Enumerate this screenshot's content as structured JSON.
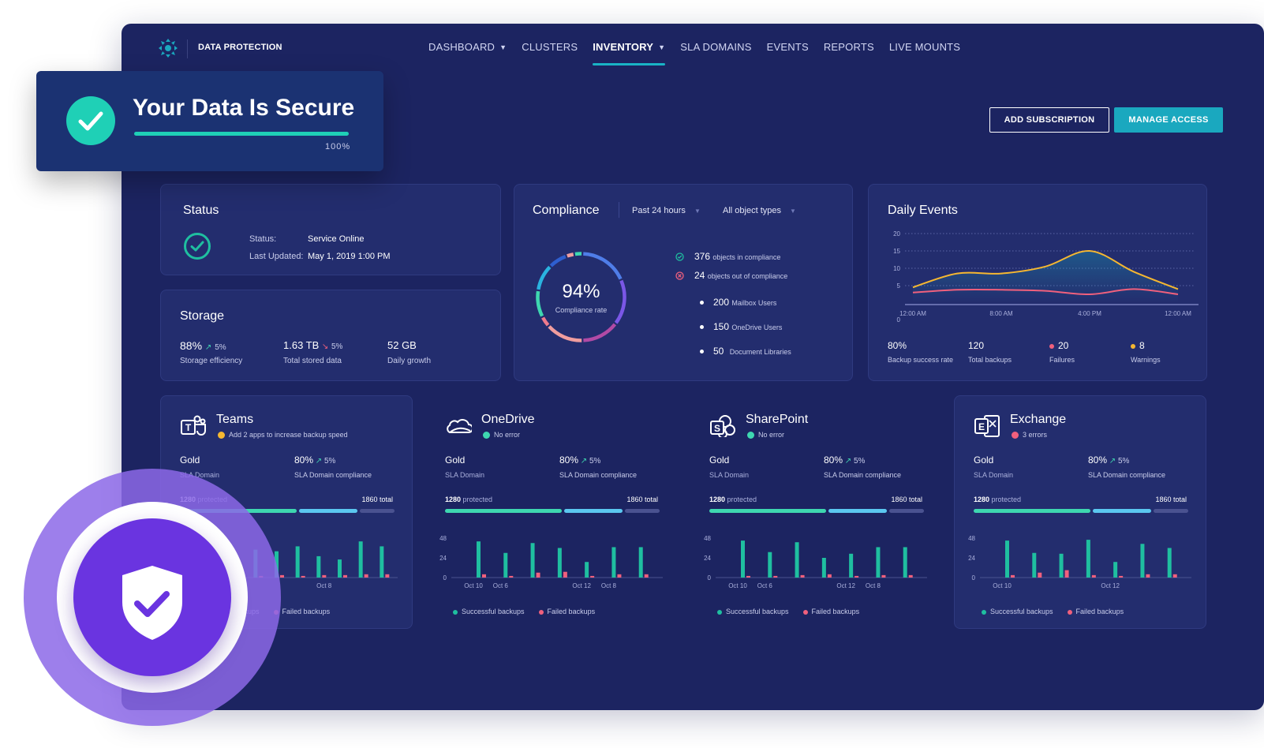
{
  "header": {
    "brand": "DATA PROTECTION",
    "nav": [
      {
        "label": "DASHBOARD",
        "dropdown": true,
        "active": false
      },
      {
        "label": "CLUSTERS",
        "dropdown": false,
        "active": false
      },
      {
        "label": "INVENTORY",
        "dropdown": true,
        "active": true
      },
      {
        "label": "SLA DOMAINS",
        "dropdown": false,
        "active": false
      },
      {
        "label": "EVENTS",
        "dropdown": false,
        "active": false
      },
      {
        "label": "REPORTS",
        "dropdown": false,
        "active": false
      },
      {
        "label": "LIVE MOUNTS",
        "dropdown": false,
        "active": false
      }
    ],
    "add_subscription": "ADD SUBSCRIPTION",
    "manage_access": "MANAGE ACCESS"
  },
  "secure_banner": {
    "title": "Your Data Is Secure",
    "progress_label": "100%",
    "progress": 1.0
  },
  "status": {
    "title": "Status",
    "status_label": "Status:",
    "status_value": "Service Online",
    "updated_label": "Last Updated:",
    "updated_value": "May 1, 2019  1:00 PM"
  },
  "storage": {
    "title": "Storage",
    "efficiency": {
      "value": "88%",
      "change": "5%",
      "label": "Storage efficiency"
    },
    "stored": {
      "value": "1.63 TB",
      "change": "5%",
      "label": "Total stored data"
    },
    "growth": {
      "value": "52 GB",
      "label": "Daily growth"
    }
  },
  "compliance": {
    "title": "Compliance",
    "filter_period": "Past 24 hours",
    "filter_type": "All object types",
    "rate": "94%",
    "rate_label": "Compliance rate",
    "in_compliance": {
      "count": "376",
      "label": "objects in compliance"
    },
    "out_compliance": {
      "count": "24",
      "label": "objects out of compliance"
    },
    "breakdown": [
      {
        "count": "200",
        "label": "Mailbox Users"
      },
      {
        "count": "150",
        "label": "OneDrive Users"
      },
      {
        "count": "50",
        "label": "Document Libraries"
      }
    ]
  },
  "daily_events": {
    "title": "Daily Events",
    "stats": [
      {
        "value": "80%",
        "label": "Backup success rate",
        "dot": ""
      },
      {
        "value": "120",
        "label": "Total backups",
        "dot": ""
      },
      {
        "value": "20",
        "label": "Failures",
        "dot": "#f0607d"
      },
      {
        "value": "8",
        "label": "Warnings",
        "dot": "#f5b731"
      }
    ]
  },
  "apps": [
    {
      "name": "Teams",
      "status": "Add 2 apps to increase backup speed",
      "status_color": "#f5b731",
      "sla": "Gold",
      "sla_label": "SLA Domain",
      "compliance": "80%",
      "compliance_change": "5%",
      "compliance_label": "SLA Domain compliance",
      "protected": "1280",
      "protected_label": "protected",
      "total": "1860 total",
      "legend_success": "Successful backups",
      "legend_failed": "Failed backups"
    },
    {
      "name": "OneDrive",
      "status": "No error",
      "status_color": "#3ed7b0",
      "sla": "Gold",
      "sla_label": "SLA Domain",
      "compliance": "80%",
      "compliance_change": "5%",
      "compliance_label": "SLA Domain compliance",
      "protected": "1280",
      "protected_label": "protected",
      "total": "1860 total",
      "legend_success": "Successful backups",
      "legend_failed": "Failed backups"
    },
    {
      "name": "SharePoint",
      "status": "No error",
      "status_color": "#3ed7b0",
      "sla": "Gold",
      "sla_label": "SLA Domain",
      "compliance": "80%",
      "compliance_change": "5%",
      "compliance_label": "SLA Domain compliance",
      "protected": "1280",
      "protected_label": "protected",
      "total": "1860 total",
      "legend_success": "Successful backups",
      "legend_failed": "Failed backups"
    },
    {
      "name": "Exchange",
      "status": "3 errors",
      "status_color": "#f0607d",
      "sla": "Gold",
      "sla_label": "SLA Domain",
      "compliance": "80%",
      "compliance_change": "5%",
      "compliance_label": "SLA Domain compliance",
      "protected": "1280",
      "protected_label": "protected",
      "total": "1860 total",
      "legend_success": "Successful backups",
      "legend_failed": "Failed backups"
    }
  ],
  "colors": {
    "accent": "#1aa8bf",
    "success": "#1fbfa0",
    "failed": "#f0607d",
    "warning": "#f5b731",
    "backup_line": "#f0607d",
    "success_line": "#f5b731"
  },
  "chart_data": [
    {
      "type": "line",
      "title": "Daily Events",
      "x": [
        "12:00 AM",
        "4:00 AM",
        "8:00 AM",
        "12:00 PM",
        "4:00 PM",
        "8:00 PM",
        "12:00 AM"
      ],
      "xticks": [
        "12:00 AM",
        "8:00 AM",
        "4:00 PM",
        "12:00 AM"
      ],
      "ylim": [
        0,
        20
      ],
      "yticks": [
        0,
        5,
        10,
        15,
        20
      ],
      "grid": true,
      "series": [
        {
          "values": [
            4.5,
            8.5,
            8.5,
            10.5,
            15,
            9,
            4
          ]
        },
        {
          "values": [
            3,
            3.8,
            3.8,
            3.5,
            2.5,
            4,
            2.5
          ]
        }
      ]
    },
    {
      "type": "pie",
      "title": "",
      "values": [
        94,
        6
      ],
      "labels": [
        "",
        ""
      ],
      "center_label": "94%"
    },
    {
      "type": "bar",
      "title": "Teams",
      "xticks": [
        "Oct 8"
      ],
      "ylim": [
        0,
        48
      ],
      "yticks": [
        0,
        24,
        48
      ],
      "series": [
        {
          "name": "Successful backups",
          "values": [
            40,
            30,
            34,
            32,
            38,
            26,
            22,
            44,
            38
          ]
        },
        {
          "name": "Failed backups",
          "values": [
            2,
            3,
            2,
            3,
            2,
            3,
            3,
            4,
            4
          ]
        }
      ]
    },
    {
      "type": "bar",
      "title": "OneDrive",
      "xticks": [
        "Oct 10",
        "Oct 6",
        "Oct 12",
        "Oct 8"
      ],
      "ylim": [
        0,
        48
      ],
      "yticks": [
        0,
        24,
        48
      ],
      "series": [
        {
          "name": "Successful backups",
          "values": [
            44,
            30,
            42,
            36,
            19,
            37,
            37
          ]
        },
        {
          "name": "Failed backups",
          "values": [
            4,
            2,
            6,
            7,
            2,
            4,
            4
          ]
        }
      ]
    },
    {
      "type": "bar",
      "title": "SharePoint",
      "xticks": [
        "Oct 10",
        "Oct 6",
        "Oct 12",
        "Oct 8"
      ],
      "ylim": [
        0,
        48
      ],
      "yticks": [
        0,
        24,
        48
      ],
      "series": [
        {
          "name": "Successful backups",
          "values": [
            45,
            31,
            43,
            24,
            29,
            37,
            37
          ]
        },
        {
          "name": "Failed backups",
          "values": [
            2,
            2,
            3,
            4,
            2,
            3,
            3
          ]
        }
      ]
    },
    {
      "type": "bar",
      "title": "Exchange",
      "xticks": [
        "Oct 10",
        "Oct 12"
      ],
      "ylim": [
        0,
        48
      ],
      "yticks": [
        0,
        24,
        48
      ],
      "series": [
        {
          "name": "Successful backups",
          "values": [
            45,
            30,
            29,
            46,
            19,
            41,
            36
          ]
        },
        {
          "name": "Failed backups",
          "values": [
            3,
            6,
            9,
            3,
            2,
            4,
            4
          ]
        }
      ]
    }
  ]
}
